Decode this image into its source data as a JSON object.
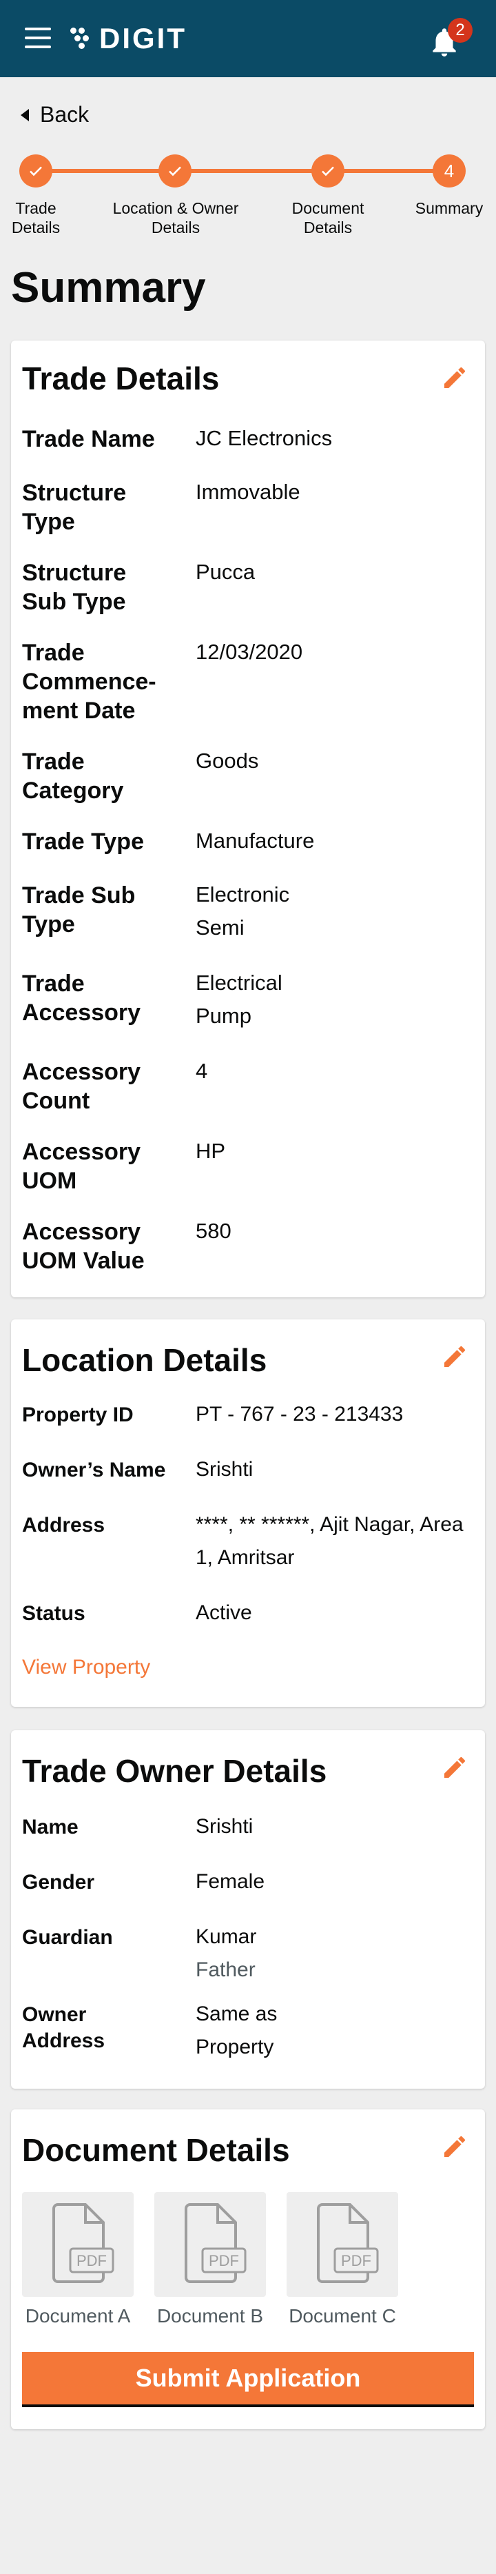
{
  "header": {
    "app_name": "DIGIT",
    "notification_count": "2"
  },
  "nav": {
    "back_label": "Back"
  },
  "stepper": {
    "steps": [
      {
        "label": "Trade Details",
        "state": "complete"
      },
      {
        "label": "Location & Owner Details",
        "state": "complete"
      },
      {
        "label": "Document Details",
        "state": "complete"
      },
      {
        "label": "Summary",
        "number": "4",
        "state": "current"
      }
    ]
  },
  "page": {
    "title": "Summary"
  },
  "trade_details": {
    "title": "Trade Details",
    "rows": [
      {
        "label": "Trade Name",
        "value": "JC Electronics"
      },
      {
        "label": "Structure Type",
        "value": "Immovable"
      },
      {
        "label": "Structure Sub Type",
        "value": "Pucca"
      },
      {
        "label": "Trade Commence-ment Date",
        "value": "12/03/2020"
      },
      {
        "label": "Trade Category",
        "value": "Goods"
      },
      {
        "label": "Trade Type",
        "value": "Manufacture"
      },
      {
        "label": "Trade Sub Type",
        "value": "Electronic Semi"
      },
      {
        "label": "Trade Accessory",
        "value": "Electrical Pump"
      },
      {
        "label": "Accessory Count",
        "value": "4"
      },
      {
        "label": "Accessory UOM",
        "value": "HP"
      },
      {
        "label": "Accessory UOM Value",
        "value": "580"
      }
    ]
  },
  "location_details": {
    "title": "Location Details",
    "rows": [
      {
        "label": "Property ID",
        "value": "PT - 767 - 23 - 213433"
      },
      {
        "label": "Owner’s Name",
        "value": "Srishti"
      },
      {
        "label": "Address",
        "value": "****, ** ******, Ajit Nagar, Area 1, Amritsar"
      },
      {
        "label": "Status",
        "value": "Active"
      }
    ],
    "link_label": "View Property"
  },
  "owner_details": {
    "title": "Trade Owner Details",
    "rows": [
      {
        "label": "Name",
        "value": "Srishti"
      },
      {
        "label": "Gender",
        "value": "Female"
      },
      {
        "label": "Guardian",
        "value": "Kumar",
        "sub": "Father"
      },
      {
        "label": "Owner Address",
        "value": "Same as Property"
      }
    ]
  },
  "document_details": {
    "title": "Document Details",
    "file_type": "PDF",
    "documents": [
      {
        "name": "Document A"
      },
      {
        "name": "Document B"
      },
      {
        "name": "Document C"
      }
    ],
    "submit_label": "Submit Application"
  },
  "colors": {
    "header_bg": "#0b4b66",
    "accent": "#f47738",
    "badge": "#d4351c",
    "page_bg": "#eeeeee"
  },
  "icons": [
    "menu-icon",
    "logo-dots-icon",
    "bell-icon",
    "back-arrow-icon",
    "check-icon",
    "edit-pencil-icon",
    "pdf-file-icon"
  ]
}
